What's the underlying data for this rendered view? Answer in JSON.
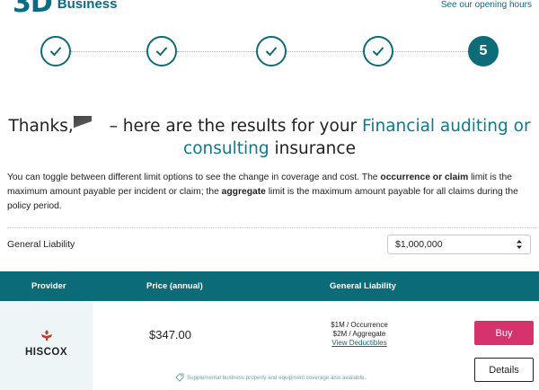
{
  "header": {
    "logo_mark": "3D",
    "logo_text": "Business",
    "opening_hours_link": "See our opening hours"
  },
  "stepper": {
    "steps": [
      {
        "state": "complete",
        "icon": "check-icon"
      },
      {
        "state": "complete",
        "icon": "check-icon"
      },
      {
        "state": "complete",
        "icon": "check-icon"
      },
      {
        "state": "complete",
        "icon": "check-icon"
      },
      {
        "state": "current",
        "label": "5"
      }
    ]
  },
  "headline": {
    "prefix": "Thanks,",
    "middle": " – here are the results for your ",
    "accent_1": "Financial auditing or",
    "accent_2": "consulting",
    "suffix": " insurance"
  },
  "intro": {
    "part1": "You can toggle between different limit options to see the change in coverage and cost. The ",
    "bold1": "occurrence or claim",
    "part2": " limit is the maximum amount payable per incident or claim; the ",
    "bold2": "aggregate",
    "part3": " limit is the maximum amount payable for all claims during the policy period."
  },
  "coverage": {
    "label": "General Liability",
    "selected": "$1,000,000"
  },
  "table": {
    "headers": {
      "provider": "Provider",
      "price": "Price (annual)",
      "general_liability": "General Liability"
    },
    "rows": [
      {
        "provider": "HISCOX",
        "price": "$347.00",
        "occurrence": "$1M / Occurrence",
        "aggregate": "$2M / Aggregate",
        "deductibles_link": "View Deductibles",
        "buy_label": "Buy",
        "details_label": "Details",
        "note": "Supplemental business property and equipment coverage also available."
      }
    ]
  },
  "colors": {
    "brand": "#0a6b84",
    "teal": "#0b6c78",
    "buy": "#d6336c"
  }
}
